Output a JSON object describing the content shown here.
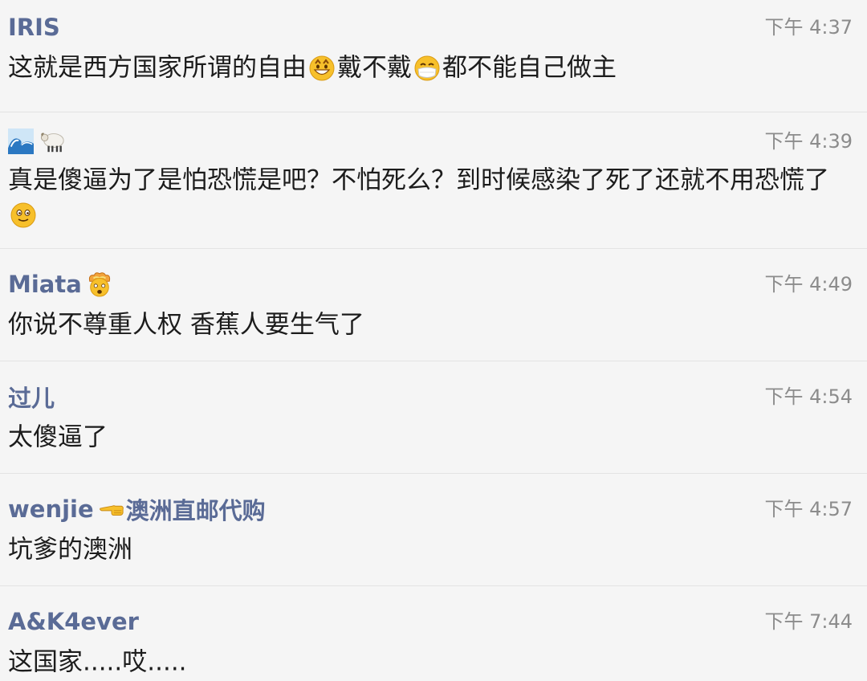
{
  "comments": [
    {
      "name": "IRIS",
      "time": "下午 4:37",
      "text_parts": [
        "这就是西方国家所谓的自由",
        "戴不戴",
        "都不能自己做主"
      ]
    },
    {
      "name": "",
      "name_icons": [
        "wave-emoji",
        "sheep-emoji"
      ],
      "time": "下午 4:39",
      "text_parts": [
        "真是傻逼为了是怕恐慌是吧？不怕死么？到时候感染了死了还就不用恐慌了"
      ]
    },
    {
      "name": "Miata",
      "name_icons": [
        "exploding-head-emoji"
      ],
      "time": "下午 4:49",
      "text_parts": [
        "你说不尊重人权 香蕉人要生气了"
      ]
    },
    {
      "name": "过儿",
      "time": "下午 4:54",
      "text_parts": [
        "太傻逼了"
      ]
    },
    {
      "name": "wenjie",
      "name_suffix": "澳洲直邮代购",
      "name_icons": [
        "pointing-left-emoji"
      ],
      "time": "下午 4:57",
      "text_parts": [
        "坑爹的澳洲"
      ]
    },
    {
      "name": "A&K4ever",
      "time": "下午 7:44",
      "text_parts": [
        "这国家.....哎....."
      ]
    }
  ],
  "colors": {
    "background": "#f5f5f5",
    "name": "#5a6b96",
    "time": "#8c8c8c",
    "text": "#1c1c1c",
    "divider": "#e3e3e3"
  }
}
